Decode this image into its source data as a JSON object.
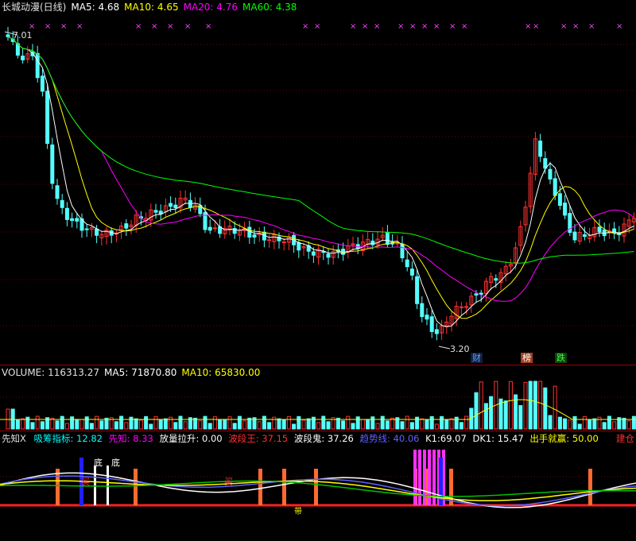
{
  "main_header": {
    "title": "长城动漫(日线)",
    "ma5": {
      "label": "MA5:",
      "value": "4.68",
      "color": "#ffffff"
    },
    "ma10": {
      "label": "MA10:",
      "value": "4.65",
      "color": "#ffff00"
    },
    "ma20": {
      "label": "MA20:",
      "value": "4.76",
      "color": "#ff00ff"
    },
    "ma60": {
      "label": "MA60:",
      "value": "4.38",
      "color": "#00ff00"
    }
  },
  "price_annotations": {
    "high": "7.01",
    "low": "3.20"
  },
  "event_flags": {
    "cai": "财",
    "bang": "榜",
    "die": "跌"
  },
  "volume_header": {
    "volume": {
      "label": "VOLUME:",
      "value": "116313.27"
    },
    "ma5": {
      "label": "MA5:",
      "value": "71870.80"
    },
    "ma10": {
      "label": "MA10:",
      "value": "65830.00"
    }
  },
  "indicator_header": {
    "name": "先知X",
    "items": [
      {
        "label": "吸筹指标:",
        "value": "12.82",
        "color": "#00ffff"
      },
      {
        "label": "先知:",
        "value": "8.33",
        "color": "#ff00ff"
      },
      {
        "label": "放量拉升:",
        "value": "0.00",
        "color": "#ffffff"
      },
      {
        "label": "波段王:",
        "value": "37.15",
        "color": "#ff3030"
      },
      {
        "label": "波段鬼:",
        "value": "37.26",
        "color": "#ffffff"
      },
      {
        "label": "趋势线:",
        "value": "40.06",
        "color": "#6060ff"
      },
      {
        "label": "K1:",
        "value": "69.07",
        "color": "#ffffff"
      },
      {
        "label": "DK1:",
        "value": "15.47",
        "color": "#ffffff"
      },
      {
        "label": "出手就赢:",
        "value": "50.00",
        "color": "#ffff00"
      }
    ],
    "right_label": "建仓"
  },
  "indicator_labels": {
    "di1": "底",
    "di2": "底",
    "buy1": "买",
    "buy2": "买",
    "dai": "带"
  },
  "colors": {
    "up": "#ff3232",
    "down": "#54ffff",
    "grid": "#800000",
    "axis": "#a00000"
  }
}
